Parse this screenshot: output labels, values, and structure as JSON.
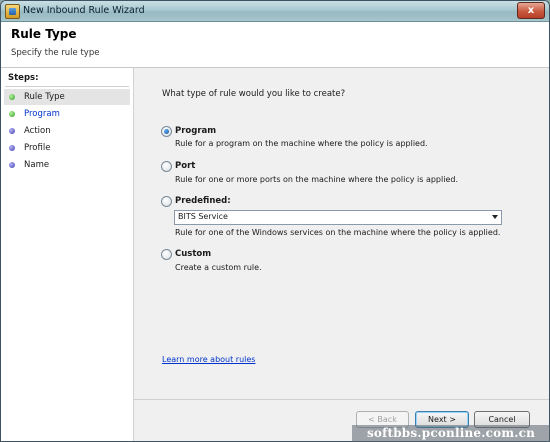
{
  "window": {
    "title": "New Inbound Rule Wizard",
    "close_glyph": "x"
  },
  "header": {
    "title": "Rule Type",
    "subtitle": "Specify the rule type"
  },
  "steps": {
    "title": "Steps:",
    "items": [
      {
        "label": "Rule Type",
        "state": "completed"
      },
      {
        "label": "Program",
        "state": "link"
      },
      {
        "label": "Action",
        "state": "pending"
      },
      {
        "label": "Profile",
        "state": "pending"
      },
      {
        "label": "Name",
        "state": "pending"
      }
    ]
  },
  "content": {
    "question": "What type of rule would you like to create?",
    "options": [
      {
        "label": "Program",
        "description": "Rule for a program on the machine where the policy is applied.",
        "selected": true
      },
      {
        "label": "Port",
        "description": "Rule for one or more ports on the machine where the policy is applied.",
        "selected": false
      },
      {
        "label": "Predefined:",
        "description": "Rule for one of the Windows services on the machine where the policy is applied.",
        "selected": false
      },
      {
        "label": "Custom",
        "description": "Create a custom rule.",
        "selected": false
      }
    ],
    "predefined_select": {
      "value": "BITS Service"
    },
    "learn_more": "Learn more about rules"
  },
  "buttons": {
    "back": "< Back",
    "next": "Next >",
    "cancel": "Cancel"
  },
  "watermark": "softbbs.pconline.com.cn",
  "colors": {
    "link": "#0033cc",
    "step_completed": "#2f9e22",
    "step_pending": "#3c3cb4"
  },
  "icons": {
    "app": "firewall-icon",
    "close": "close-icon",
    "dropdown": "chevron-down-icon"
  }
}
